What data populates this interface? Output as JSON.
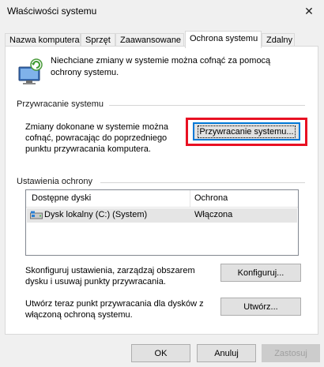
{
  "window": {
    "title": "Właściwości systemu",
    "close_glyph": "✕"
  },
  "tabs": [
    {
      "label": "Nazwa komputera",
      "active": false
    },
    {
      "label": "Sprzęt",
      "active": false
    },
    {
      "label": "Zaawansowane",
      "active": false
    },
    {
      "label": "Ochrona systemu",
      "active": true
    },
    {
      "label": "Zdalny",
      "active": false
    }
  ],
  "header": {
    "icon": "computer-protection-icon",
    "text": "Niechciane zmiany w systemie można cofnąć za pomocą ochrony systemu."
  },
  "restore_section": {
    "label": "Przywracanie systemu",
    "description": "Zmiany dokonane w systemie można cofnąć, powracając do poprzedniego punktu przywracania komputera.",
    "button_label": "Przywracanie systemu...",
    "highlight_color": "#e81123"
  },
  "protection_section": {
    "label": "Ustawienia ochrony",
    "columns": [
      "Dostępne dyski",
      "Ochrona"
    ],
    "rows": [
      {
        "disk": "Dysk lokalny (C:) (System)",
        "protection": "Włączona",
        "icon": "drive-icon"
      }
    ]
  },
  "configure": {
    "description": "Skonfiguruj ustawienia, zarządzaj obszarem dysku i usuwaj punkty przywracania.",
    "button_label": "Konfiguruj..."
  },
  "create": {
    "description": "Utwórz teraz punkt przywracania dla dysków z włączoną ochroną systemu.",
    "button_label": "Utwórz..."
  },
  "footer": {
    "ok_label": "OK",
    "cancel_label": "Anuluj",
    "apply_label": "Zastosuj"
  }
}
